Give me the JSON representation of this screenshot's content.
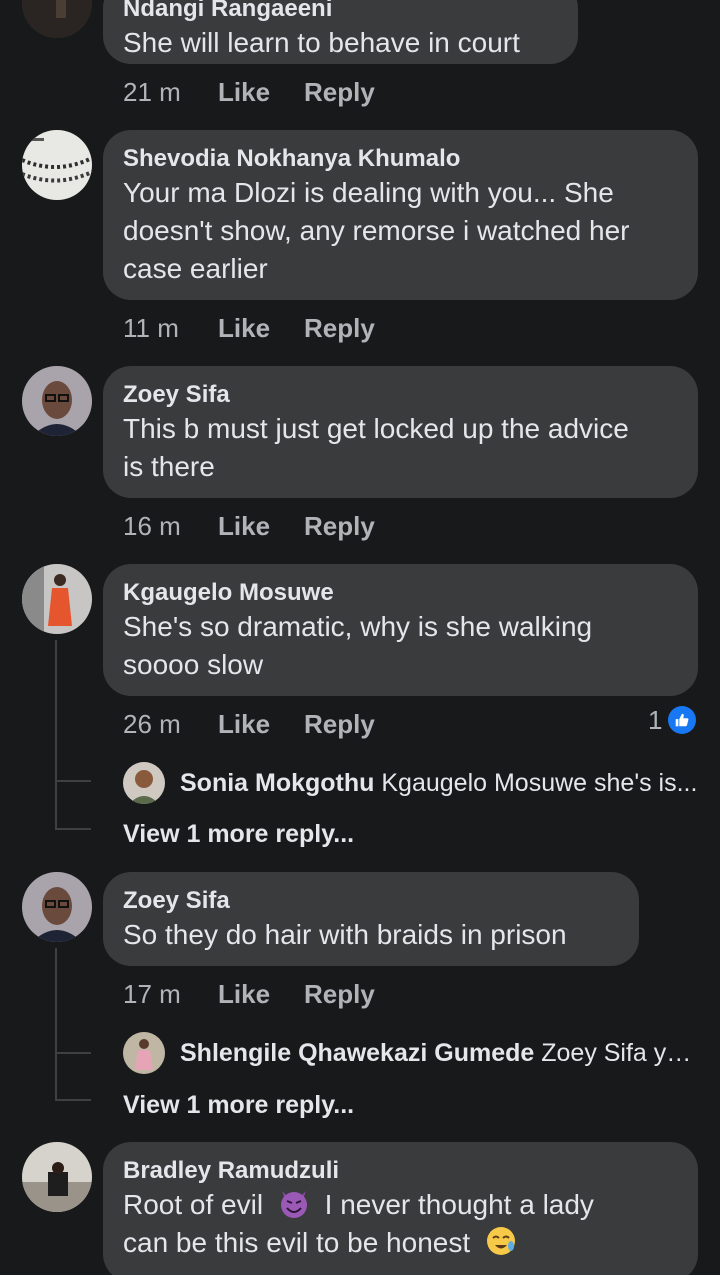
{
  "comments": [
    {
      "name": "Ndangi Rangaeeni",
      "text": "She will learn to behave in court",
      "time": "21 m",
      "like": "Like",
      "reply": "Reply",
      "avatar_icon": "avatar-silhouette-icon"
    },
    {
      "name": "Shevodia Nokhanya Khumalo",
      "line1": "Your ma Dlozi is dealing with you... She",
      "line2": "doesn't show, any remorse i watched her",
      "line3": "case earlier",
      "time": "11 m",
      "like": "Like",
      "reply": "Reply",
      "avatar_icon": "avatar-beads-icon"
    },
    {
      "name": "Zoey Sifa",
      "line1": "This b must just get locked up the advice",
      "line2": "is there",
      "time": "16 m",
      "like": "Like",
      "reply": "Reply",
      "avatar_icon": "avatar-woman-glasses-icon"
    },
    {
      "name": "Kgaugelo Mosuwe",
      "line1": "She's so dramatic, why is she walking",
      "line2": "soooo slow",
      "time": "26 m",
      "like": "Like",
      "reply": "Reply",
      "reaction_count": "1",
      "reaction_icon": "like-reaction-icon",
      "avatar_icon": "avatar-woman-orange-dress-icon",
      "reply_preview": {
        "name": "Sonia Mokgothu",
        "text": "Kgaugelo Mosuwe she's is..."
      },
      "view_more": "View 1 more reply..."
    },
    {
      "name": "Zoey Sifa",
      "text": "So they do hair with braids in prison",
      "time": "17 m",
      "like": "Like",
      "reply": "Reply",
      "avatar_icon": "avatar-woman-glasses-icon",
      "reply_preview": {
        "name": "Shlengile Qhawekazi Gumede",
        "text": "Zoey Sifa ye..."
      },
      "view_more": "View 1 more reply..."
    },
    {
      "name": "Bradley Ramudzuli",
      "line1_a": "Root of evil",
      "line1_b": "I never thought a lady",
      "line2": "can be this evil to be honest",
      "emoji1": "smiling-devil-emoji",
      "emoji2": "crying-laughing-emoji",
      "avatar_icon": "avatar-room-icon"
    }
  ],
  "colors": {
    "background": "#18191a",
    "bubble": "#3a3b3c",
    "text": "#e4e6eb",
    "secondary_text": "#b0b3b8",
    "like_blue": "#1877f2"
  }
}
